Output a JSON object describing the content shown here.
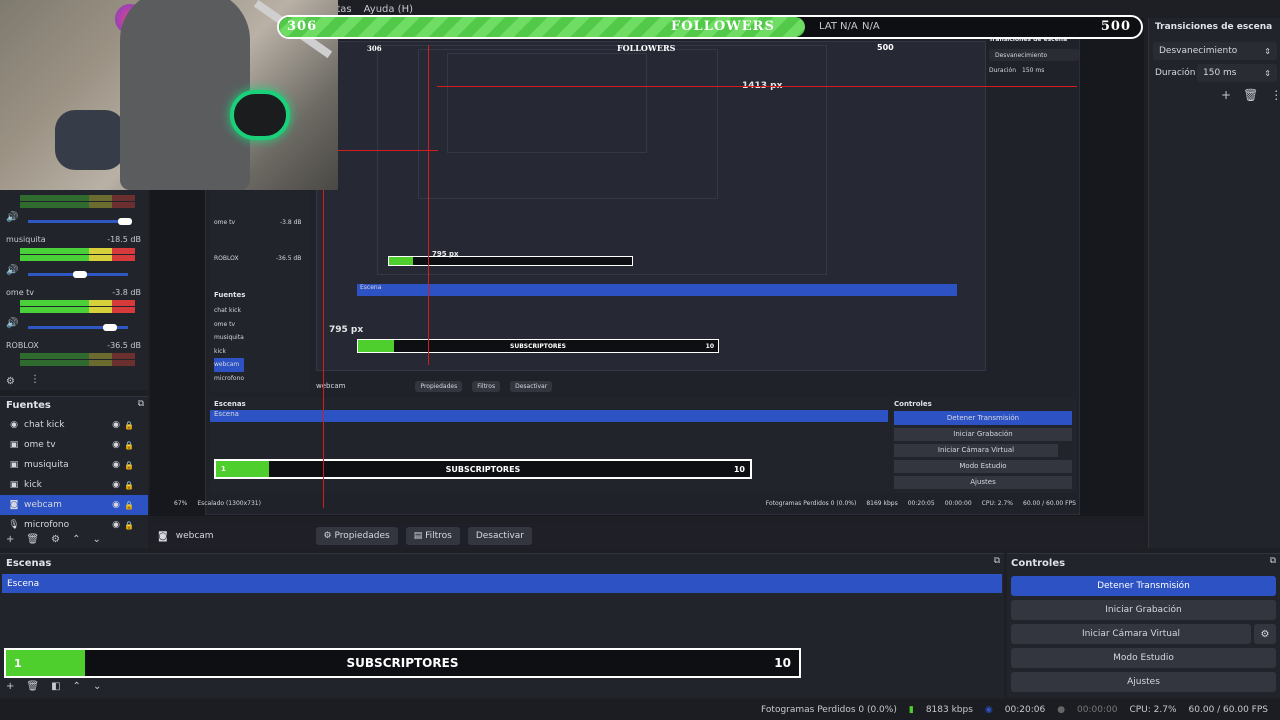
{
  "menu": {
    "items": [
      "ntas",
      "Ayuda (H)"
    ]
  },
  "followers": {
    "current": "306",
    "label": "FOLLOWERS",
    "goal": "500",
    "lat_label": "LAT",
    "na1": "N/A",
    "na2": "N/A",
    "progress": 0.61
  },
  "nested": {
    "followers_current": "306",
    "followers_label": "FOLLOWERS",
    "followers_goal": "500",
    "px1": "1413 px",
    "px2": "795 px",
    "px3": "795 px",
    "fuentes_title": "Fuentes",
    "escenas_title": "Escenas",
    "controles_title": "Controles",
    "escena": "Escena",
    "subs_start": "1",
    "subs_label": "SUBSCRIPTORES",
    "subs_goal": "10",
    "webcam": "webcam",
    "propiedades": "Propiedades",
    "filtros": "Filtros",
    "desactivar": "Desactivar",
    "detener": "Detener Transmisión",
    "grabacion": "Iniciar Grabación",
    "camara": "Iniciar Cámara Virtual",
    "estudio": "Modo Estudio",
    "ajustes": "Ajustes",
    "zoom": "67%",
    "escalado": "Escalado (1300x731)",
    "status_frames": "Fotogramas Perdidos 0 (0.0%)",
    "status_kbps": "8169 kbps",
    "status_time": "00:20:05",
    "status_rec": "00:00:00",
    "status_cpu": "CPU: 2.7%",
    "status_fps": "60.00 / 60.00 FPS",
    "transiciones": "Transiciones de escena",
    "desvanecimiento": "Desvanecimiento",
    "duracion": "Duración",
    "ms": "150 ms",
    "sources": [
      "chat kick",
      "ome tv",
      "musiquita",
      "kick",
      "webcam",
      "microfono"
    ],
    "tracks": [
      {
        "name": "ome tv",
        "db": "-3.8 dB"
      },
      {
        "name": "ROBLOX",
        "db": "-36.5 dB"
      }
    ]
  },
  "mixer": {
    "tracks": [
      {
        "name": "musiquita",
        "db": "-18.5 dB"
      },
      {
        "name": "ome tv",
        "db": "-3.8 dB"
      },
      {
        "name": "ROBLOX",
        "db": "-36.5 dB"
      }
    ],
    "scale": "-60-55-50-45-40-35-30-25-20-15-10-5-0"
  },
  "fuentes": {
    "title": "Fuentes",
    "items": [
      {
        "label": "chat kick",
        "icon": "globe-icon"
      },
      {
        "label": "ome tv",
        "icon": "window-icon"
      },
      {
        "label": "musiquita",
        "icon": "window-icon"
      },
      {
        "label": "kick",
        "icon": "window-icon"
      },
      {
        "label": "webcam",
        "icon": "camera-icon"
      },
      {
        "label": "microfono",
        "icon": "mic-icon"
      }
    ]
  },
  "propbar": {
    "source": "webcam",
    "propiedades": "Propiedades",
    "filtros": "Filtros",
    "desactivar": "Desactivar"
  },
  "escenas": {
    "title": "Escenas",
    "items": [
      "Escena"
    ]
  },
  "subs": {
    "start": "1",
    "label": "SUBSCRIPTORES",
    "goal": "10",
    "progress": 0.1
  },
  "controles": {
    "title": "Controles",
    "detener": "Detener Transmisión",
    "grabacion": "Iniciar Grabación",
    "camara": "Iniciar Cámara Virtual",
    "estudio": "Modo Estudio",
    "ajustes": "Ajustes"
  },
  "status": {
    "frames": "Fotogramas Perdidos 0 (0.0%)",
    "kbps": "8183 kbps",
    "time": "00:20:06",
    "rec": "00:00:00",
    "cpu": "CPU: 2.7%",
    "fps": "60.00 / 60.00 FPS"
  },
  "transiciones": {
    "title": "Transiciones de escena",
    "type": "Desvanecimiento",
    "duracion_label": "Duración",
    "duracion": "150 ms"
  },
  "colors": {
    "accent": "#2c52c4",
    "progress_green": "#4fcf2e",
    "red_guide": "#d21e1e"
  }
}
